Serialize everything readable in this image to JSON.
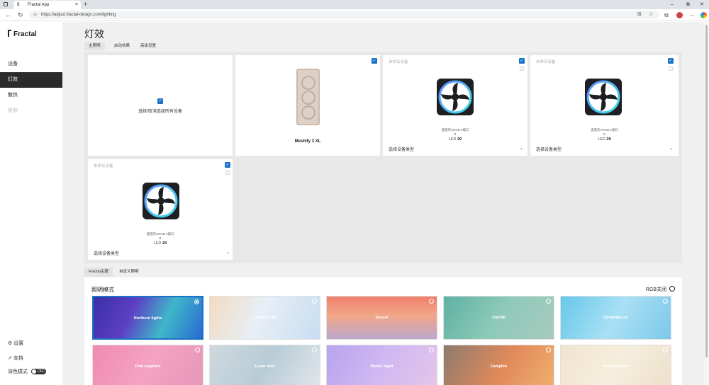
{
  "browser": {
    "tab_title": "Fractal App",
    "tab_favicon": "$",
    "tab_close": "×",
    "new_tab": "+",
    "url": "https://adjust.fractal-design.com/lighting",
    "win_min": "–",
    "win_max": "⧉",
    "win_close": "✕"
  },
  "sidebar": {
    "logo": "Fractal",
    "items": [
      {
        "label": "设备"
      },
      {
        "label": "灯效"
      },
      {
        "label": "散热"
      },
      {
        "label": "音频"
      }
    ],
    "settings": "设置",
    "support": "支持",
    "dark_mode": "深色模式",
    "dark_mode_state": "OFF"
  },
  "main": {
    "title": "灯效",
    "tabs": [
      {
        "label": "主照明"
      },
      {
        "label": "启动效果"
      },
      {
        "label": "高级设置"
      }
    ],
    "select_all_label": "选择/取消选择所有设备",
    "case_name": "Meshify 3 XL",
    "devices": [
      {
        "title": "未命名设备",
        "fan_name": "速度的ARGB 2端口",
        "fan_port": "B",
        "led_label": "LED",
        "led_count": "20",
        "type_placeholder": "选择设备类型"
      },
      {
        "title": "未命名设备",
        "fan_name": "速度的ARGB 2端口",
        "fan_port": "B",
        "led_label": "LED",
        "led_count": "20",
        "type_placeholder": "选择设备类型"
      },
      {
        "title": "未命名设备",
        "fan_name": "速度的ARGB 2端口",
        "fan_port": "B",
        "led_label": "LED",
        "led_count": "20",
        "type_placeholder": "选择设备类型"
      }
    ]
  },
  "lower": {
    "tabs": [
      {
        "label": "Fractal主题"
      },
      {
        "label": "自定义照明"
      }
    ],
    "section_title": "照明模式",
    "rgb_off": "RGB关闭",
    "themes": [
      {
        "name": "Northern lights",
        "selected": true
      },
      {
        "name": "Summer sky"
      },
      {
        "name": "Sunset"
      },
      {
        "name": "Starfall"
      },
      {
        "name": "Glistering ice"
      },
      {
        "name": "Pink sapphire"
      },
      {
        "name": "Lunar mist"
      },
      {
        "name": "Mystic night"
      },
      {
        "name": "Campfire"
      },
      {
        "name": "Ancient dawn"
      }
    ]
  },
  "colors": {
    "accent": "#1a73c8",
    "active_nav": "#2b2b2b",
    "panel_bg": "#e8e8e8"
  }
}
